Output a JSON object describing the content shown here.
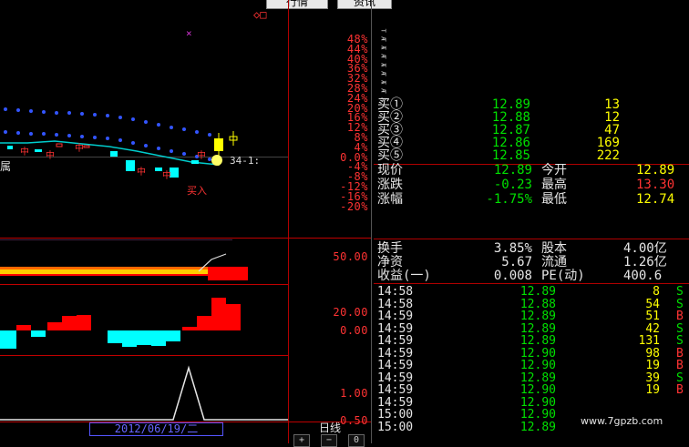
{
  "tabs": [
    "行情",
    "资讯"
  ],
  "top_indicators": {
    "purple": "×",
    "marks": "◇□"
  },
  "main_axis": [
    "48%",
    "44%",
    "40%",
    "36%",
    "32%",
    "28%",
    "24%",
    "20%",
    "16%",
    "12%",
    "8%",
    "4%",
    "0.0%",
    "-4%",
    "-8%",
    "-12%",
    "-16%",
    "-20%"
  ],
  "chart_labels": {
    "left_text": "属",
    "price_tag": "34-1:",
    "buy_signal": "买入",
    "mid_label": "中"
  },
  "side_strip": [
    "T A",
    "T A",
    "T A",
    "T A",
    "T A",
    "T A",
    "T A",
    "T A"
  ],
  "order_book": [
    {
      "label": "买①",
      "price": "12.89",
      "vol": "13"
    },
    {
      "label": "买②",
      "price": "12.88",
      "vol": "12"
    },
    {
      "label": "买③",
      "price": "12.87",
      "vol": "47"
    },
    {
      "label": "买④",
      "price": "12.86",
      "vol": "169"
    },
    {
      "label": "买⑤",
      "price": "12.85",
      "vol": "222"
    }
  ],
  "quote": [
    {
      "l1": "现价",
      "v1": "12.89",
      "l2": "今开",
      "v2": "12.89"
    },
    {
      "l1": "涨跌",
      "v1": "-0.23",
      "l2": "最高",
      "v2": "13.30"
    },
    {
      "l1": "涨幅",
      "v1": "-1.75%",
      "l2": "最低",
      "v2": "12.74"
    }
  ],
  "stats": [
    {
      "l1": "换手",
      "v1": "3.85%",
      "l2": "股本",
      "v2": "4.00亿"
    },
    {
      "l1": "净资",
      "v1": "5.67",
      "l2": "流通",
      "v2": "1.26亿"
    },
    {
      "l1": "收益(一)",
      "v1": "0.008",
      "l2": "PE(动)",
      "v2": "400.6"
    }
  ],
  "ticks": [
    {
      "time": "14:58",
      "price": "12.89",
      "vol": "8",
      "side": "S"
    },
    {
      "time": "14:58",
      "price": "12.88",
      "vol": "54",
      "side": "S"
    },
    {
      "time": "14:59",
      "price": "12.89",
      "vol": "51",
      "side": "B"
    },
    {
      "time": "14:59",
      "price": "12.89",
      "vol": "42",
      "side": "S"
    },
    {
      "time": "14:59",
      "price": "12.89",
      "vol": "131",
      "side": "S"
    },
    {
      "time": "14:59",
      "price": "12.90",
      "vol": "98",
      "side": "B"
    },
    {
      "time": "14:59",
      "price": "12.90",
      "vol": "19",
      "side": "B"
    },
    {
      "time": "14:59",
      "price": "12.89",
      "vol": "39",
      "side": "S"
    },
    {
      "time": "14:59",
      "price": "12.90",
      "vol": "19",
      "side": "B"
    },
    {
      "time": "14:59",
      "price": "12.90",
      "vol": "",
      "side": ""
    },
    {
      "time": "15:00",
      "price": "12.90",
      "vol": "",
      "side": ""
    },
    {
      "time": "15:00",
      "price": "12.89",
      "vol": "",
      "side": ""
    }
  ],
  "sub_axes": {
    "p1": "50.00",
    "p2a": "20.00",
    "p2b": "0.00",
    "p3a": "1.00",
    "p3b": "0.50"
  },
  "date_label": "2012/06/19/二",
  "period_label": "日线",
  "buttons": [
    "+",
    "−",
    "0"
  ],
  "watermark": "www.7gpzb.com",
  "colors": {
    "up": "#ff3333",
    "down": "#00ffff",
    "grid": "#b00000",
    "price_green": "#00e000",
    "vol_yellow": "#ffff00"
  }
}
